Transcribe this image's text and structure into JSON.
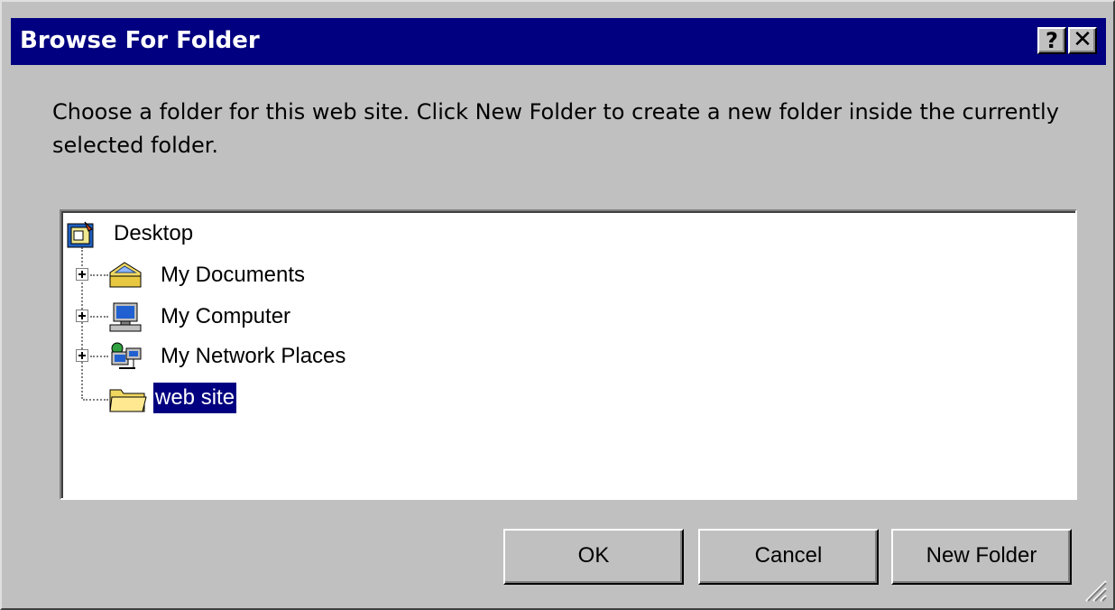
{
  "window": {
    "title": "Browse For Folder",
    "help_label": "?",
    "close_label": "✕"
  },
  "description": "Choose a folder for this web site. Click New Folder to create a new folder inside the currently selected folder.",
  "tree": {
    "items": [
      {
        "label": "Desktop",
        "icon": "desktop-icon",
        "expandable": false
      },
      {
        "label": "My Documents",
        "icon": "my-documents-folder-icon",
        "expandable": true
      },
      {
        "label": "My Computer",
        "icon": "my-computer-icon",
        "expandable": true
      },
      {
        "label": "My Network Places",
        "icon": "network-places-icon",
        "expandable": true
      },
      {
        "label": "web site",
        "icon": "folder-icon",
        "expandable": false,
        "selected": true
      }
    ]
  },
  "buttons": {
    "ok": "OK",
    "cancel": "Cancel",
    "new_folder": "New Folder"
  },
  "colors": {
    "titlebar": "#000080",
    "face": "#c0c0c0",
    "selection": "#000080"
  }
}
